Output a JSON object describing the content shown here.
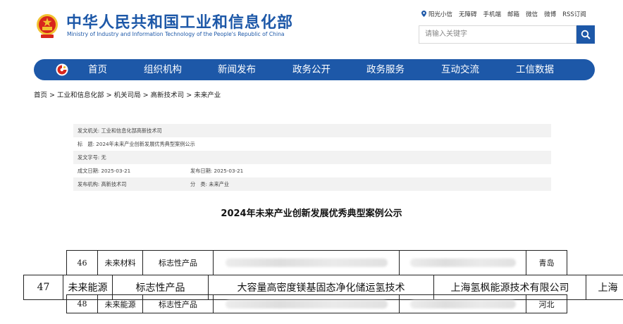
{
  "header": {
    "title": "中华人民共和国工业和信息化部",
    "subtitle": "Ministry of Industry and Information Technology of the People's Republic of China",
    "toplinks": [
      "阳光小信",
      "无障碍",
      "手机端",
      "邮箱",
      "微信",
      "微博",
      "RSS订阅"
    ],
    "search_placeholder": "请输入关键字"
  },
  "nav": {
    "items": [
      "首页",
      "组织机构",
      "新闻发布",
      "政务公开",
      "政务服务",
      "互动交流",
      "工信数据"
    ]
  },
  "breadcrumb": [
    "首页",
    "工业和信息化部",
    "机关司局",
    "高新技术司",
    "未来产业"
  ],
  "breadcrumb_sep": ">",
  "meta": {
    "issuer_label": "发文机关:",
    "issuer": "工业和信息化部高新技术司",
    "title_label": "标　题:",
    "title": "2024年未来产业创新发展优秀典型案例公示",
    "docno_label": "发文字号:",
    "docno": "无",
    "created_label": "成文日期:",
    "created": "2025-03-21",
    "published_label": "发布日期:",
    "published": "2025-03-21",
    "org_label": "发布机构:",
    "org": "高新技术司",
    "category_label": "分　类:",
    "category": "未来产业"
  },
  "doc_title": "2024年未来产业创新发展优秀典型案例公示",
  "table": {
    "rows": [
      {
        "no": "46",
        "field": "未来材料",
        "type": "标志性产品",
        "name": "",
        "company": "",
        "region": "青岛"
      },
      {
        "no": "47",
        "field": "未来能源",
        "type": "标志性产品",
        "name": "大容量高密度镁基固态净化储运氢技术",
        "company": "上海氢枫能源技术有限公司",
        "region": "上海"
      },
      {
        "no": "48",
        "field": "未来能源",
        "type": "标志性产品",
        "name": "",
        "company": "",
        "region": "河北"
      }
    ]
  },
  "colors": {
    "brand_blue": "#1d58a8",
    "emblem_red": "#d8261c",
    "emblem_gold": "#f2c230"
  }
}
